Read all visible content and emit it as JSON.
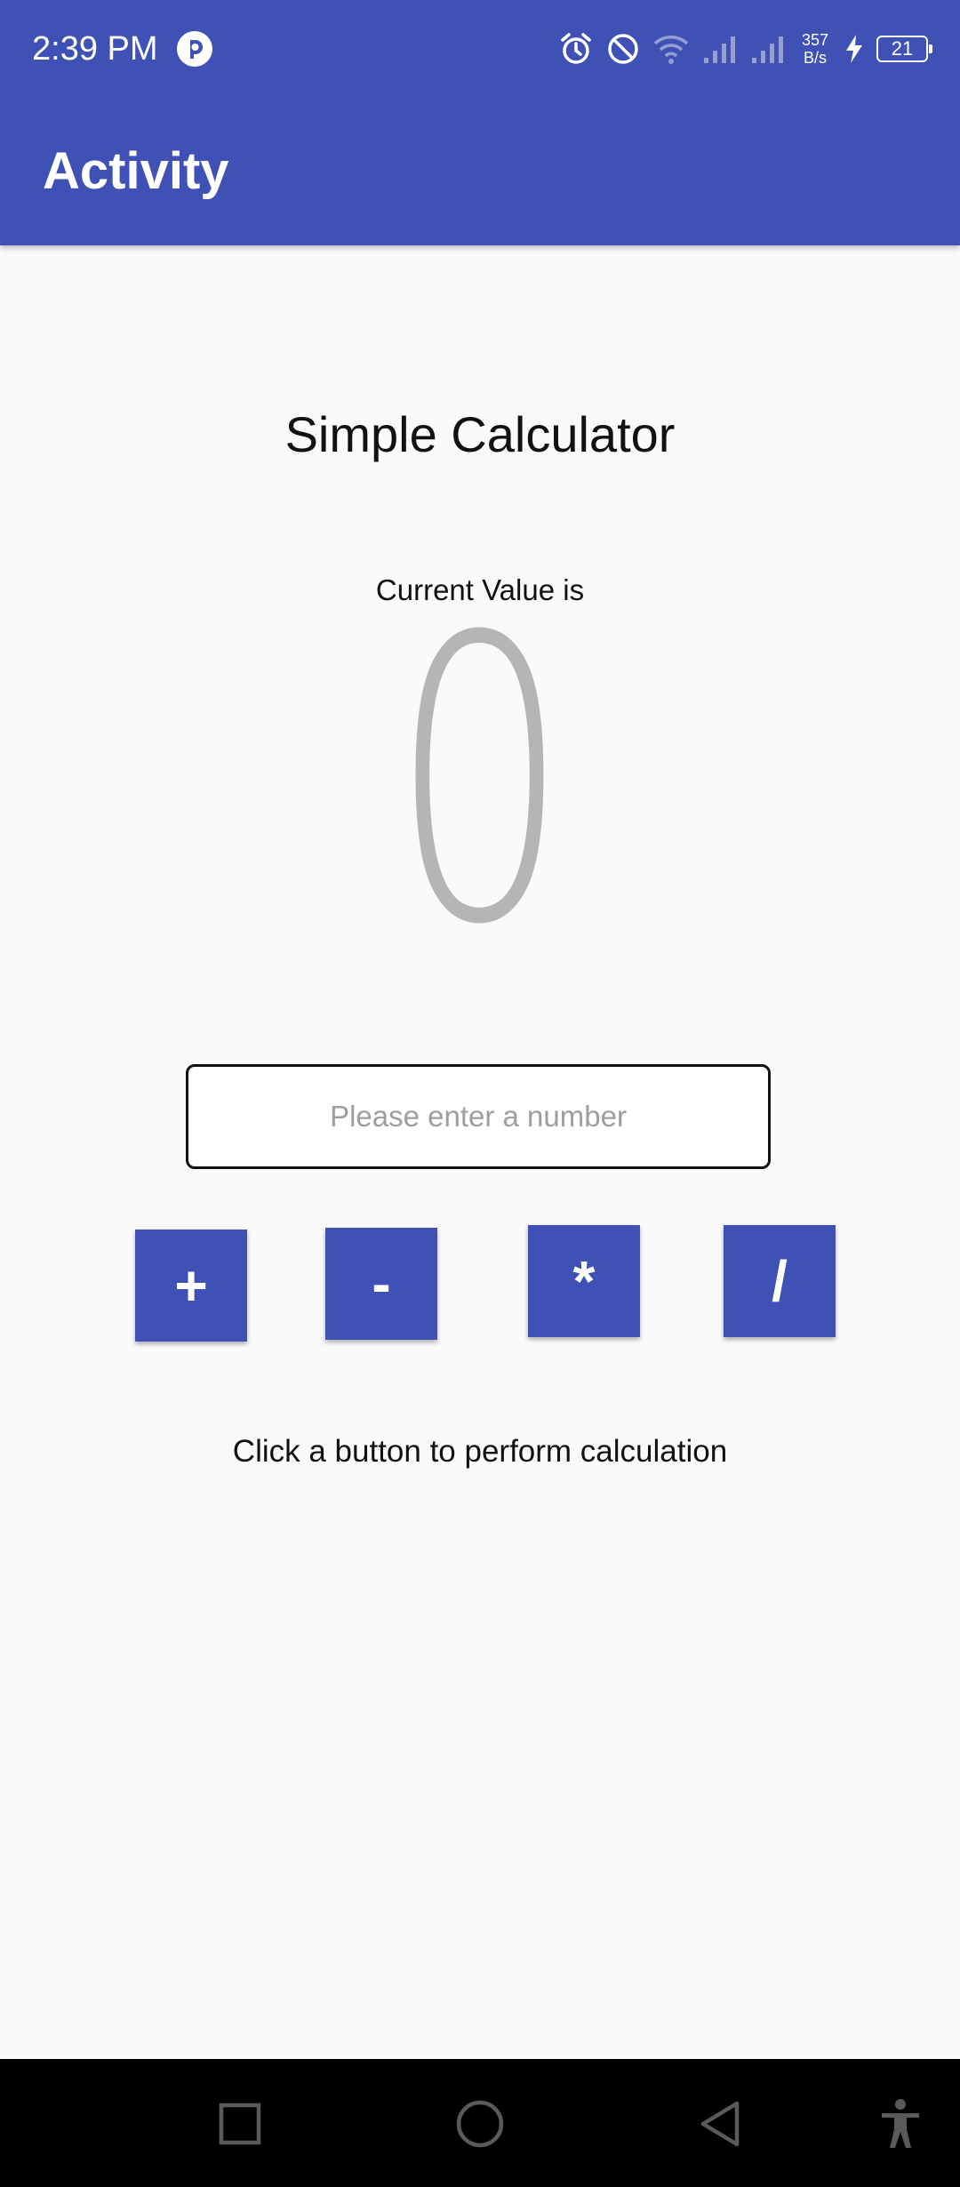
{
  "status_bar": {
    "time": "2:39 PM",
    "net_speed_value": "357",
    "net_speed_unit": "B/s",
    "battery": "21",
    "icons": [
      "app-notification-icon",
      "alarm-icon",
      "do-not-disturb-icon",
      "wifi-icon",
      "signal-icon",
      "signal-icon",
      "charging-icon",
      "battery-icon"
    ]
  },
  "app_bar": {
    "title": "Activity",
    "color": "#3f51b5"
  },
  "calculator": {
    "title": "Simple Calculator",
    "current_label": "Current Value is",
    "current_value": "0",
    "input_placeholder": "Please enter a number",
    "input_value": "",
    "buttons": {
      "add": "+",
      "subtract": "-",
      "multiply": "*",
      "divide": "/"
    },
    "hint": "Click a button to perform calculation"
  },
  "nav_bar": {
    "icons": [
      "recents-icon",
      "home-icon",
      "back-icon",
      "accessibility-icon"
    ]
  }
}
